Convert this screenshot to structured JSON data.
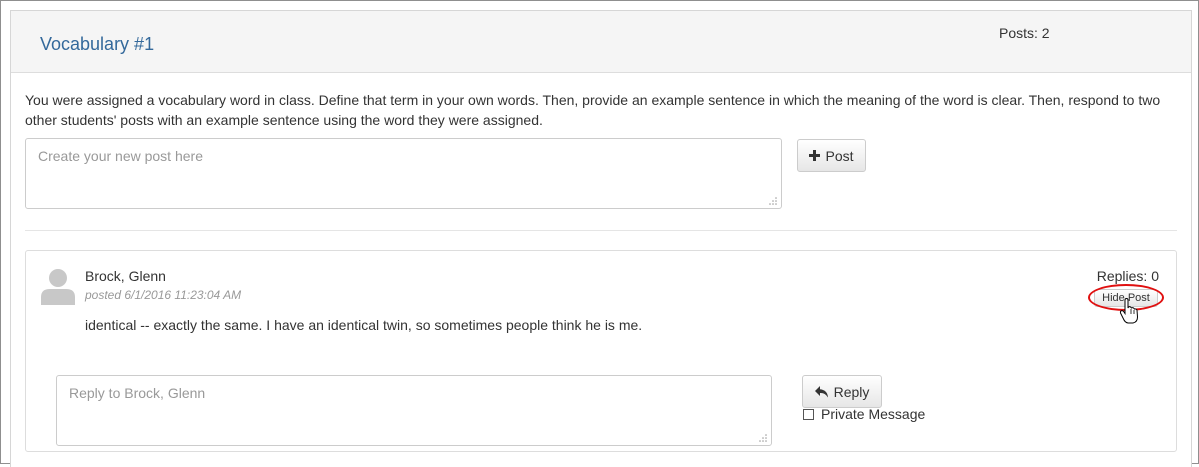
{
  "forum": {
    "title": "Vocabulary #1",
    "posts_count": "Posts: 2",
    "prompt": "You were assigned a vocabulary word in class. Define that term in your own words. Then, provide an example sentence in which the meaning of the word is clear. Then, respond to two other students' posts with an example sentence using the word they were assigned."
  },
  "new_post": {
    "placeholder": "Create your new post here",
    "button_label": "Post",
    "button_icon": "plus-icon"
  },
  "post": {
    "author": "Brock, Glenn",
    "posted": "posted 6/1/2016 11:23:04 AM",
    "body": "identical -- exactly the same. I have an identical twin, so sometimes people think he is me.",
    "replies": "Replies: 0",
    "hide_label": "Hide Post",
    "avatar_icon": "user-avatar-icon",
    "reply": {
      "placeholder": "Reply to Brock, Glenn",
      "button_label": "Reply",
      "button_icon": "reply-arrow-icon",
      "private_label": "Private Message"
    }
  },
  "colors": {
    "title": "#34699b",
    "header_bg": "#f5f5f5",
    "highlight": "#e01010"
  }
}
